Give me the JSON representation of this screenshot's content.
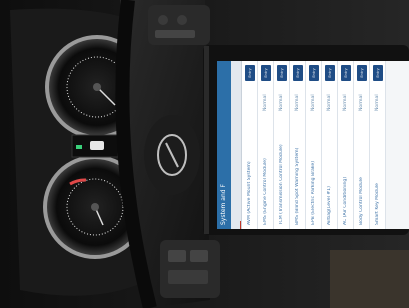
{
  "screen": {
    "title": "System and F",
    "tabs": [
      "",
      "",
      ""
    ],
    "rows": [
      {
        "name": "AVM (Active Mount System)",
        "status": ""
      },
      {
        "name": "EMS (Engine Control Module)",
        "status": "Normal"
      },
      {
        "name": "TCM (Transmission Control Module)",
        "status": "Normal"
      },
      {
        "name": "BMS (Blind Spot Warning System)",
        "status": "Normal"
      },
      {
        "name": "EPB (Electric Parking Brake)",
        "status": "Normal"
      },
      {
        "name": "Airbag(Level #1)",
        "status": "Normal"
      },
      {
        "name": "AC (Air Conditioning)",
        "status": "Normal"
      },
      {
        "name": "Body Control Module",
        "status": "Normal"
      },
      {
        "name": "Smart Key Module",
        "status": "Normal"
      }
    ],
    "button_label": "Entry"
  },
  "colors": {
    "screen_header": "#2c6fa8",
    "button": "#1f4d86",
    "gauge_red": "#e04848"
  }
}
